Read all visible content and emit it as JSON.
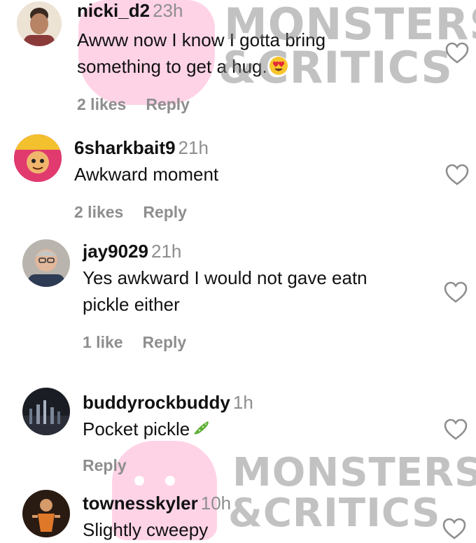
{
  "watermark": {
    "line1": "MONSTERS",
    "line2": "&CRITICS"
  },
  "icons": {
    "heart": "heart-icon",
    "emoji_heart_eyes": "heart-eyes-emoji",
    "emoji_cucumber": "cucumber-emoji"
  },
  "comments": [
    {
      "username": "nicki_d2",
      "time": "23h",
      "text_line1": "Awww now I know I gotta bring",
      "text_line2": "something to get a hug.",
      "likes": "2 likes",
      "reply": "Reply"
    },
    {
      "username": "6sharkbait9",
      "time": "21h",
      "text_line1": "Awkward moment",
      "likes": "2 likes",
      "reply": "Reply"
    },
    {
      "username": "jay9029",
      "time": "21h",
      "text_line1": "Yes awkward I would not gave eatn",
      "text_line2": "pickle either",
      "likes": "1 like",
      "reply": "Reply"
    },
    {
      "username": "buddyrockbuddy",
      "time": "1h",
      "text_line1": "Pocket pickle",
      "reply": "Reply"
    },
    {
      "username": "townesskyler",
      "time": "10h",
      "text_line1": "Slightly cweepy"
    }
  ]
}
